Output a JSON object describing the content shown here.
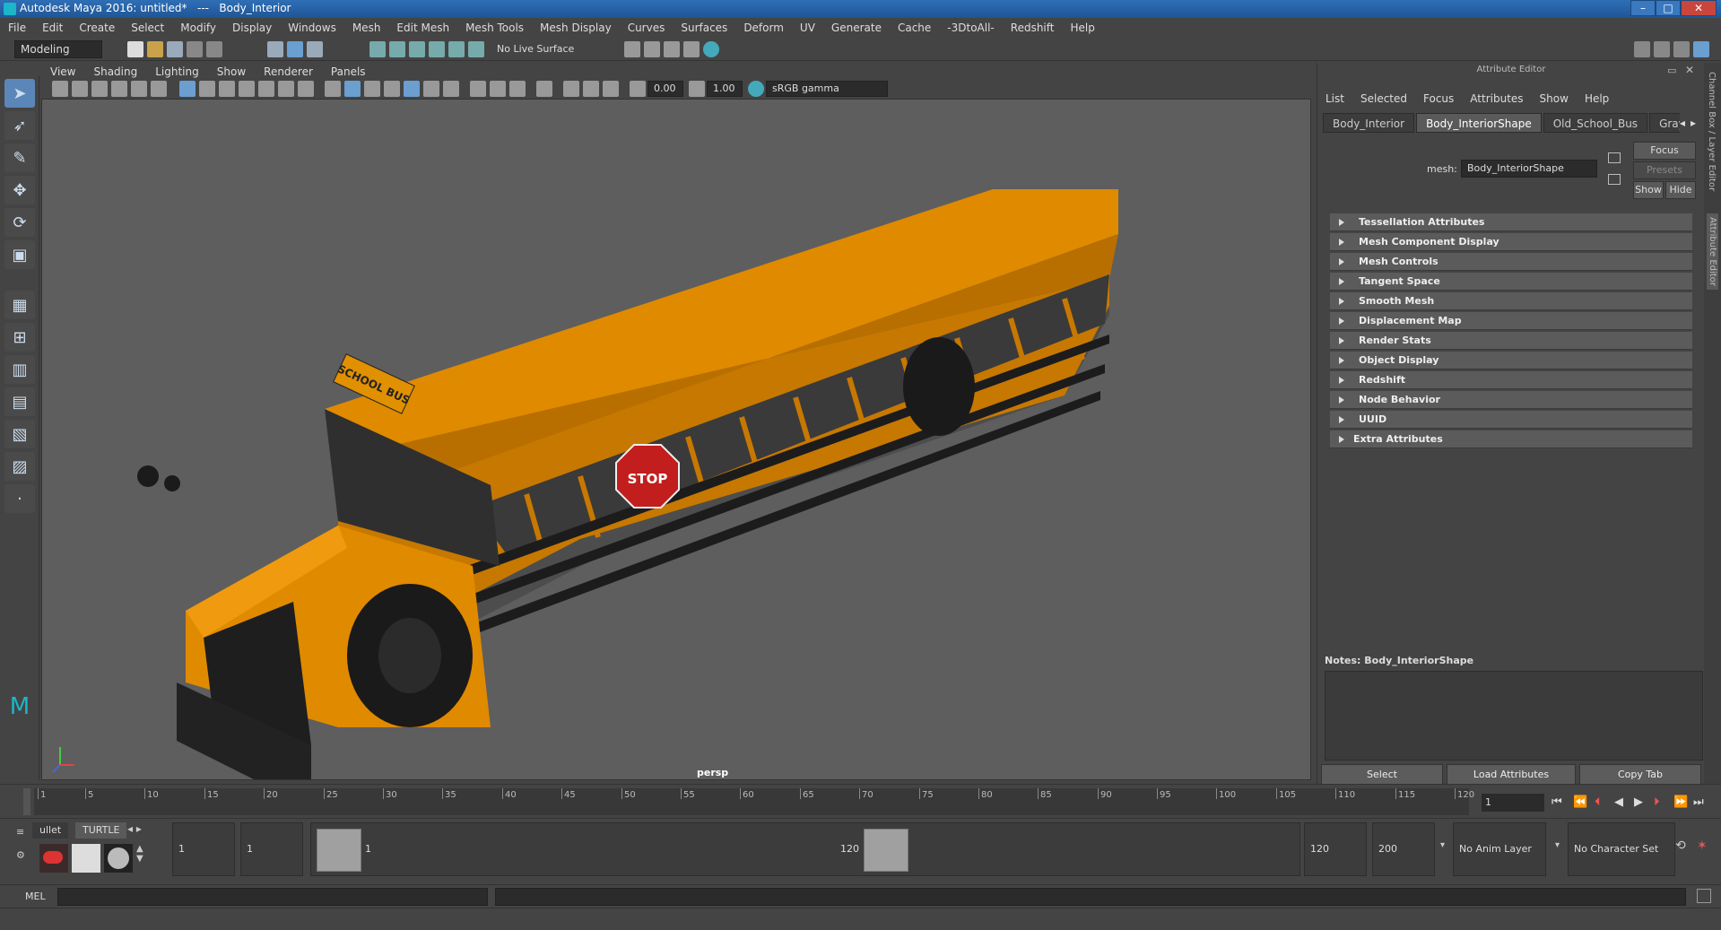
{
  "window": {
    "title": "Autodesk Maya 2016: untitled*   ---   Body_Interior"
  },
  "menubar": [
    "File",
    "Edit",
    "Create",
    "Select",
    "Modify",
    "Display",
    "Windows",
    "Mesh",
    "Edit Mesh",
    "Mesh Tools",
    "Mesh Display",
    "Curves",
    "Surfaces",
    "Deform",
    "UV",
    "Generate",
    "Cache",
    "-3DtoAll-",
    "Redshift",
    "Help"
  ],
  "statusline": {
    "menuset": "Modeling",
    "live_surface": "No Live Surface"
  },
  "viewport": {
    "menu": [
      "View",
      "Shading",
      "Lighting",
      "Show",
      "Renderer",
      "Panels"
    ],
    "exposure": "0.00",
    "gamma": "1.00",
    "colorspace": "sRGB gamma",
    "camera_label": "persp",
    "bus_sign": "SCHOOL BUS",
    "stop_sign": "STOP"
  },
  "attribute_editor": {
    "title": "Attribute Editor",
    "menu": [
      "List",
      "Selected",
      "Focus",
      "Attributes",
      "Show",
      "Help"
    ],
    "tabs": [
      "Body_Interior",
      "Body_InteriorShape",
      "Old_School_Bus",
      "Graypaint"
    ],
    "active_tab": "Body_InteriorShape",
    "mesh_label": "mesh:",
    "mesh_value": "Body_InteriorShape",
    "focus_btn": "Focus",
    "presets_btn": "Presets",
    "show_btn": "Show",
    "hide_btn": "Hide",
    "sections": [
      "Tessellation Attributes",
      "Mesh Component Display",
      "Mesh Controls",
      "Tangent Space",
      "Smooth Mesh",
      "Displacement Map",
      "Render Stats",
      "Object Display",
      "Redshift",
      "Node Behavior",
      "UUID",
      "Extra Attributes"
    ],
    "notes_label": "Notes:  Body_InteriorShape",
    "select_btn": "Select",
    "load_btn": "Load Attributes",
    "copy_btn": "Copy Tab"
  },
  "side_strip": {
    "channel_box": "Channel Box / Layer Editor",
    "attr_editor": "Attribute Editor"
  },
  "timeline": {
    "ticks": [
      "1",
      "5",
      "10",
      "15",
      "20",
      "25",
      "30",
      "35",
      "40",
      "45",
      "50",
      "55",
      "60",
      "65",
      "70",
      "75",
      "80",
      "85",
      "90",
      "95",
      "100",
      "105",
      "110",
      "115",
      "120"
    ],
    "current_frame": "1"
  },
  "range": {
    "shelf_tabs": [
      "ullet",
      "TURTLE"
    ],
    "start": "1",
    "playback_start": "1",
    "slider_start": "1",
    "slider_end": "120",
    "playback_end": "120",
    "end": "200",
    "anim_layer": "No Anim Layer",
    "char_set": "No Character Set"
  },
  "cmdline": {
    "label": "MEL"
  }
}
